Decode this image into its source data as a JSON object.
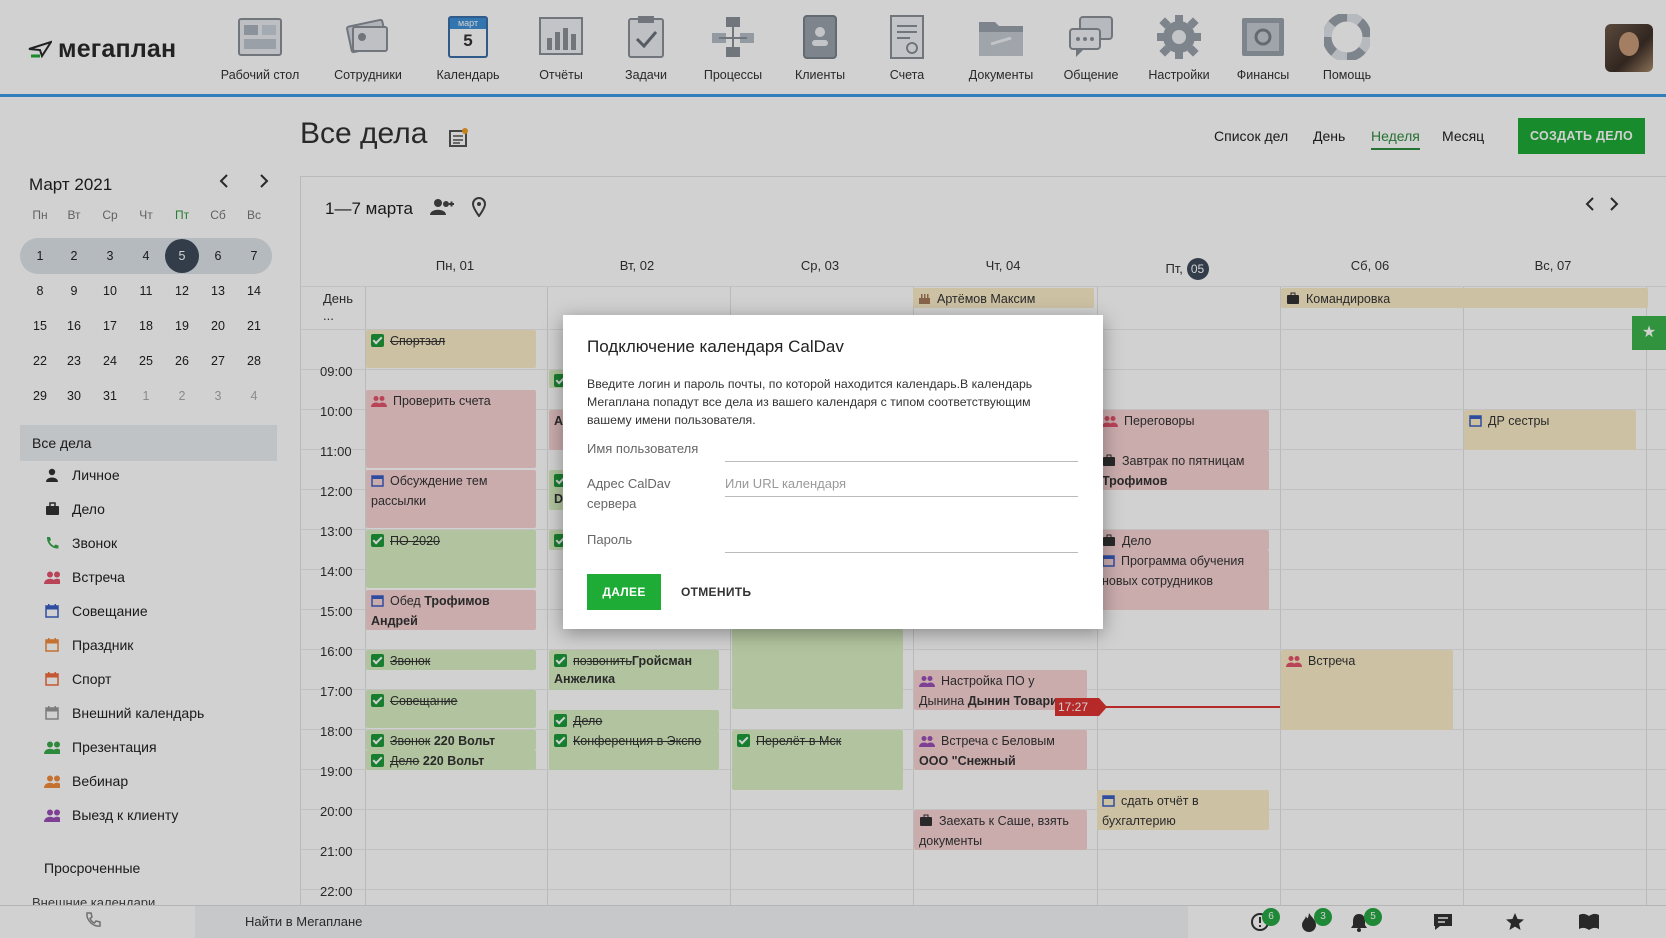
{
  "app": {
    "logo": "мегаплан"
  },
  "nav": [
    {
      "label": "Рабочий стол",
      "icon": "dashboard-icon"
    },
    {
      "label": "Сотрудники",
      "icon": "employees-icon"
    },
    {
      "label": "Календарь",
      "icon": "calendar-icon",
      "month": "март",
      "day": "5"
    },
    {
      "label": "Отчёты",
      "icon": "reports-icon"
    },
    {
      "label": "Задачи",
      "icon": "tasks-icon"
    },
    {
      "label": "Процессы",
      "icon": "processes-icon"
    },
    {
      "label": "Клиенты",
      "icon": "clients-icon"
    },
    {
      "label": "Счета",
      "icon": "invoices-icon"
    },
    {
      "label": "Документы",
      "icon": "documents-icon"
    },
    {
      "label": "Общение",
      "icon": "chat-icon"
    },
    {
      "label": "Настройки",
      "icon": "gear-icon"
    },
    {
      "label": "Финансы",
      "icon": "safe-icon"
    },
    {
      "label": "Помощь",
      "icon": "lifebuoy-icon"
    }
  ],
  "minical": {
    "title": "Март 2021",
    "weekdays": [
      "Пн",
      "Вт",
      "Ср",
      "Чт",
      "Пт",
      "Сб",
      "Вс"
    ],
    "weeks": [
      [
        "1",
        "2",
        "3",
        "4",
        "5",
        "6",
        "7"
      ],
      [
        "8",
        "9",
        "10",
        "11",
        "12",
        "13",
        "14"
      ],
      [
        "15",
        "16",
        "17",
        "18",
        "19",
        "20",
        "21"
      ],
      [
        "22",
        "23",
        "24",
        "25",
        "26",
        "27",
        "28"
      ],
      [
        "29",
        "30",
        "31",
        "1",
        "2",
        "3",
        "4"
      ]
    ],
    "today": "5"
  },
  "sidebar": {
    "all": "Все дела",
    "categories": [
      {
        "label": "Личное",
        "icon": "person-icon",
        "color": "#333333"
      },
      {
        "label": "Дело",
        "icon": "briefcase-icon",
        "color": "#333333"
      },
      {
        "label": "Звонок",
        "icon": "phone-icon",
        "color": "#3aa84a"
      },
      {
        "label": "Встреча",
        "icon": "people-icon",
        "color": "#e2526b"
      },
      {
        "label": "Совещание",
        "icon": "calendar-icon",
        "color": "#3a5fc4"
      },
      {
        "label": "Праздник",
        "icon": "calendar-icon",
        "color": "#f08a3c"
      },
      {
        "label": "Спорт",
        "icon": "calendar-icon",
        "color": "#f06a3c"
      },
      {
        "label": "Внешний календарь",
        "icon": "calendar-icon",
        "color": "#999999"
      },
      {
        "label": "Презентация",
        "icon": "people-icon",
        "color": "#3aa84a"
      },
      {
        "label": "Вебинар",
        "icon": "people-icon",
        "color": "#f08a3c"
      },
      {
        "label": "Выезд к клиенту",
        "icon": "people-icon",
        "color": "#9a4fb5"
      }
    ],
    "overdue": "Просроченные",
    "external": "Внешние календари"
  },
  "page": {
    "title": "Все дела",
    "views": [
      "Список дел",
      "День",
      "Неделя",
      "Месяц"
    ],
    "active_view": "Неделя",
    "create": "СОЗДАТЬ ДЕЛО"
  },
  "week": {
    "range": "1—7 марта",
    "days": [
      "Пн, 01",
      "Вт, 02",
      "Ср, 03",
      "Чт, 04",
      "Пт,",
      "Сб, 06",
      "Вс, 07"
    ],
    "today_num": "05",
    "allday_label": "День ...",
    "hours": [
      "09:00",
      "10:00",
      "11:00",
      "12:00",
      "13:00",
      "14:00",
      "15:00",
      "16:00",
      "17:00",
      "18:00",
      "19:00",
      "20:00",
      "21:00",
      "22:00"
    ],
    "now": "17:27"
  },
  "events": {
    "artemov": "Артёмов Максим",
    "komandirovka": "Командировка",
    "sportzal": "Спортзал",
    "proverit": "Проверить счета",
    "obsuzhdenie": "Обсуждение тем рассылки",
    "po2020": "ПО 2020",
    "obed": "Обед",
    "obed_who": "Трофимов Андрей",
    "zvonok": "Звонок",
    "soveshanie": "Совещание",
    "zvonok220": "Звонок",
    "zvonok220_b": "220 Вольт",
    "delo220": "Дело",
    "delo220_b": "220 Вольт",
    "pozvonit": "позвонить",
    "pozvonit_b": "Гройсман Анжелика",
    "delo2": "Дело",
    "konferenciya": "Конференция в Экспо",
    "perelet": "Перелёт в Мск",
    "peregovory": "Переговоры",
    "zavtrak": "Завтрак по пятницам",
    "zavtrak_b": "Трофимов",
    "delo_fri": "Дело",
    "programma": "Программа обучения новых сотрудников",
    "nastroyka": "Настройка ПО у Дынина",
    "nastroyka_b": "Дынин Товарищ",
    "vstrecha_bel": "Встреча с Беловым",
    "vstrecha_bel_b": "ООО \"Снежный",
    "zaehat": "Заехать к Саше, взять документы",
    "otchet": "сдать отчёт в бухгалтерию",
    "vstrecha_sat": "Встреча",
    "dr": "ДР сестры",
    "trunc_a": "А",
    "trunc_d": "D"
  },
  "dialog": {
    "title": "Подключение календаря CalDav",
    "desc": "Введите логин и пароль почты, по которой находится календарь.В календарь Мегаплана попадут все дела из вашего календаря с типом соответствующим вашему имени пользователя.",
    "username_label": "Имя пользователя",
    "server_label": "Адрес CalDav сервера",
    "server_placeholder": "Или URL календаря",
    "password_label": "Пароль",
    "ok": "ДАЛЕЕ",
    "cancel": "ОТМЕНИТЬ"
  },
  "bottom": {
    "search": "Найти в Мегаплане",
    "badges": [
      "6",
      "3",
      "5"
    ]
  }
}
